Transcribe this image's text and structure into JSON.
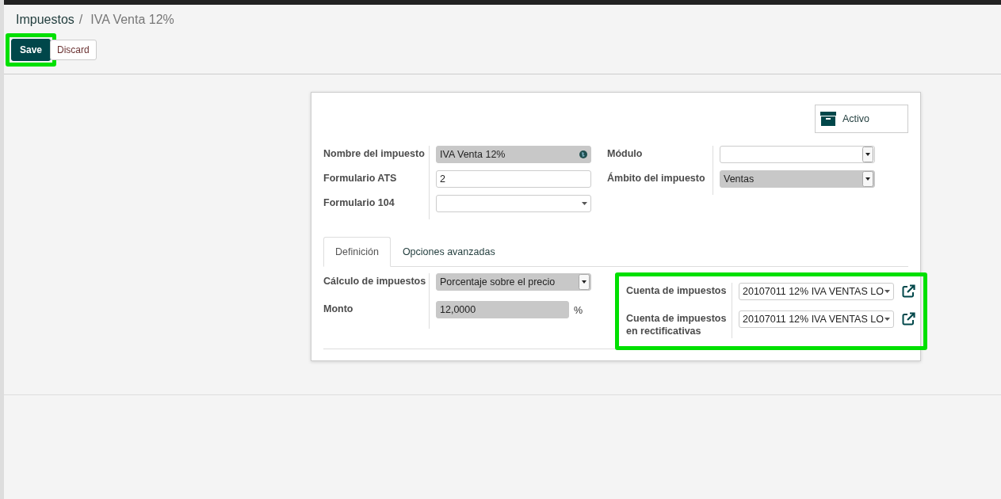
{
  "breadcrumb": [
    {
      "label": "Impuestos",
      "kind": "link"
    },
    {
      "label": "/",
      "kind": "separator"
    },
    {
      "label": "IVA Venta 12%",
      "kind": "current"
    }
  ],
  "buttons": [
    {
      "label": "Save",
      "kind": "primary",
      "highlighted": true
    },
    {
      "label": "Discard",
      "kind": "default",
      "highlighted": false
    }
  ],
  "status_button": {
    "label": "Activo"
  },
  "groups": [
    {
      "highlighted": false,
      "fields": [
        {
          "label": "Nombre del impuesto",
          "kind": "text",
          "value": "IVA Venta 12%",
          "required": true,
          "translatable": true
        },
        {
          "label": "Formulario ATS",
          "kind": "text",
          "value": "2",
          "required": false
        },
        {
          "label": "Formulario 104",
          "kind": "many2one",
          "required": false
        }
      ]
    },
    {
      "highlighted": false,
      "fields": [
        {
          "label": "Módulo",
          "kind": "select",
          "required": false
        },
        {
          "label": "Ámbito del impuesto",
          "kind": "select",
          "value": "Ventas",
          "required": true
        }
      ]
    }
  ],
  "tabs": [
    {
      "label": "Definición",
      "selected": true
    },
    {
      "label": "Opciones avanzadas",
      "selected": false
    }
  ],
  "tab_groups": [
    {
      "highlighted": false,
      "fields": [
        {
          "label": "Cálculo de impuestos",
          "kind": "select",
          "value": "Porcentaje sobre el precio",
          "required": true
        },
        {
          "label": "Monto",
          "kind": "text",
          "value": "12,0000",
          "required": true,
          "suffix": "%"
        }
      ]
    },
    {
      "highlighted": true,
      "fields": [
        {
          "label": "Cuenta de impuestos",
          "kind": "many2one",
          "value": "20107011 12% IVA VENTAS LO",
          "required": false,
          "external_link": true
        },
        {
          "label": "Cuenta de impuestos en rectificativas",
          "kind": "many2one",
          "value": "20107011 12% IVA VENTAS LO",
          "required": false,
          "external_link": true
        }
      ]
    }
  ]
}
